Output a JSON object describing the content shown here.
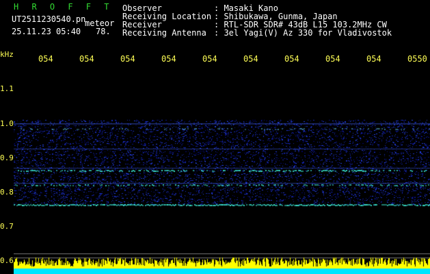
{
  "header": {
    "logo": "H R O F F T",
    "filename": "UT2511230540.pn",
    "file_suffix": "meteor",
    "datetime": "25.11.23 05:40",
    "count": "78.",
    "info_labels": [
      "Observer",
      "Receiving Location",
      "Receiver",
      "Receiving Antenna"
    ],
    "info_values": [
      ": Masaki Kano",
      ": Shibukawa, Gunma, Japan",
      ": RTL-SDR SDR# 43dB L15 103.2MHz CW",
      ": 3el Yagi(V) Az 330 for Vladivostok"
    ]
  },
  "axis": {
    "unit": "kHz",
    "x_ticks": [
      "054",
      "054",
      "054",
      "054",
      "054",
      "054",
      "054",
      "054",
      "054",
      "0550"
    ],
    "y_ticks": [
      "1.1",
      "1.0",
      "0.9",
      "0.8",
      "0.7",
      "0.6"
    ]
  },
  "colors": {
    "background": "#000000",
    "noise": "#1a2fb8",
    "signal": "#3cf0d8",
    "meter_yellow": "#ffff00",
    "meter_cyan": "#00e5ff",
    "label": "#ffff55",
    "logo": "#33dd33"
  }
}
